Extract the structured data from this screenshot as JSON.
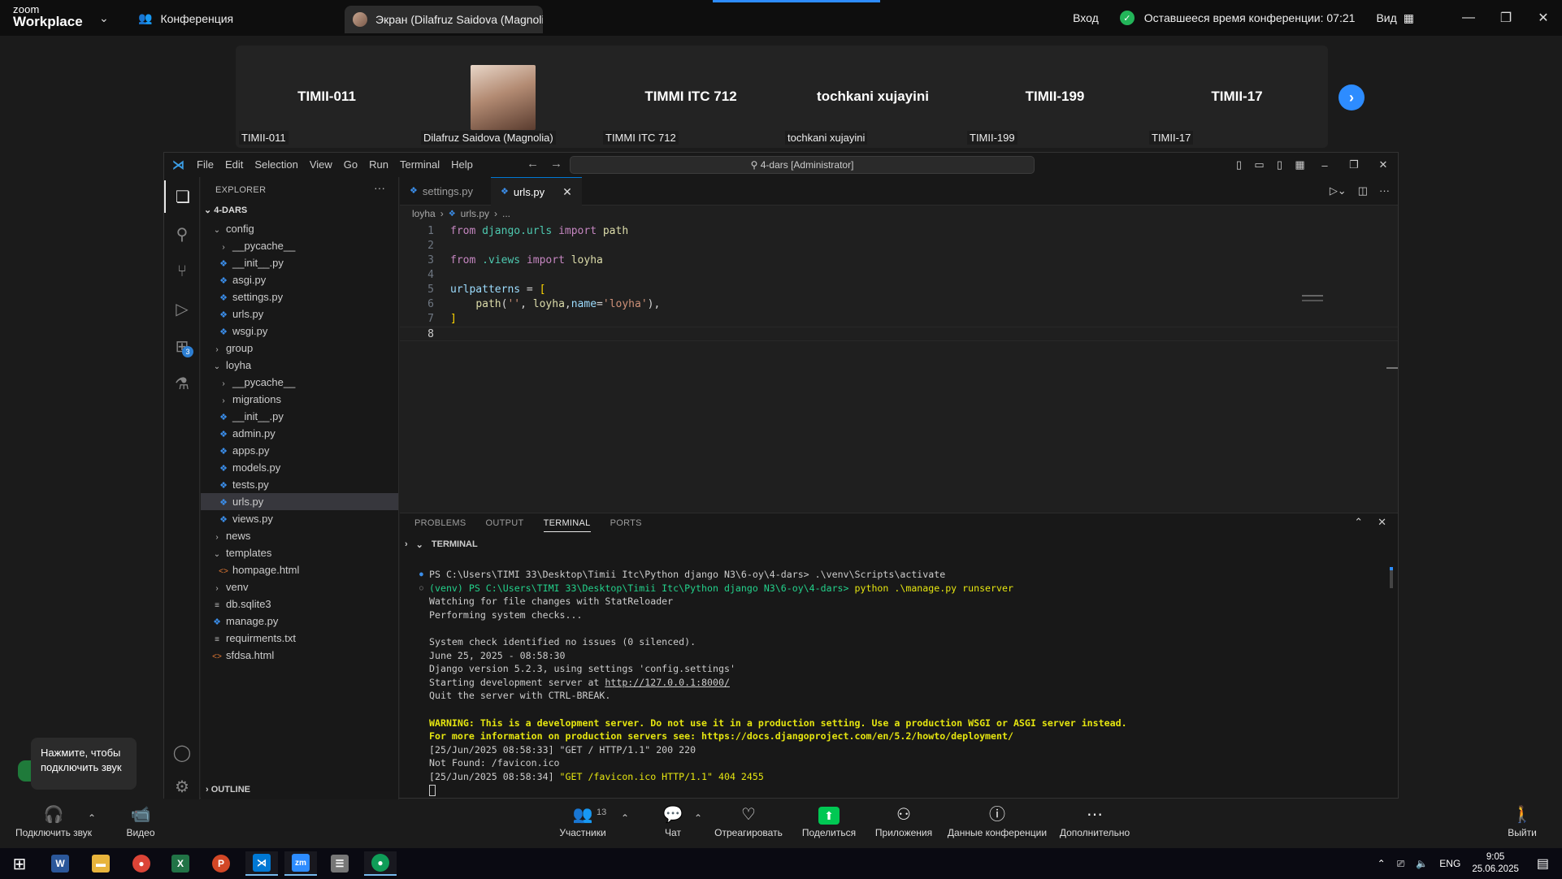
{
  "zoom": {
    "logo_line1": "zoom",
    "logo_line2": "Workplace",
    "conference_label": "Конференция",
    "screen_tab_label": "Экран (Dilafruz Saidova (Magnoli",
    "login_label": "Вход",
    "time_left": "Оставшееся время конференции: 07:21",
    "view_label": "Вид",
    "participants": [
      {
        "big": "TIMII-011",
        "small": "TIMII-011"
      },
      {
        "big": "",
        "small": "Dilafruz Saidova (Magnolia)"
      },
      {
        "big": "TIMMI ITC 712",
        "small": "TIMMI ITC 712"
      },
      {
        "big": "tochkani xujayini",
        "small": "tochkani xujayini"
      },
      {
        "big": "TIMII-199",
        "small": "TIMII-199"
      },
      {
        "big": "TIMII-17",
        "small": "TIMII-17"
      }
    ],
    "tooltip": "Нажмите, чтобы подключить звук",
    "toolbar": {
      "audio": "Подключить звук",
      "video": "Видео",
      "participants": "Участники",
      "participants_count": "13",
      "chat": "Чат",
      "react": "Отреагировать",
      "share": "Поделиться",
      "apps": "Приложения",
      "info": "Данные конференции",
      "more": "Дополнительно",
      "leave": "Выйти"
    }
  },
  "vscode": {
    "menu": [
      "File",
      "Edit",
      "Selection",
      "View",
      "Go",
      "Run",
      "Terminal",
      "Help"
    ],
    "search": "4-dars [Administrator]",
    "explorer_title": "EXPLORER",
    "root_folder": "4-DARS",
    "tree": [
      {
        "label": "config",
        "kind": "folder-open",
        "indent": 1
      },
      {
        "label": "__pycache__",
        "kind": "folder",
        "indent": 2
      },
      {
        "label": "__init__.py",
        "kind": "py",
        "indent": 2
      },
      {
        "label": "asgi.py",
        "kind": "py",
        "indent": 2
      },
      {
        "label": "settings.py",
        "kind": "py",
        "indent": 2
      },
      {
        "label": "urls.py",
        "kind": "py",
        "indent": 2
      },
      {
        "label": "wsgi.py",
        "kind": "py",
        "indent": 2
      },
      {
        "label": "group",
        "kind": "folder",
        "indent": 1
      },
      {
        "label": "loyha",
        "kind": "folder-open",
        "indent": 1
      },
      {
        "label": "__pycache__",
        "kind": "folder",
        "indent": 2
      },
      {
        "label": "migrations",
        "kind": "folder",
        "indent": 2
      },
      {
        "label": "__init__.py",
        "kind": "py",
        "indent": 2
      },
      {
        "label": "admin.py",
        "kind": "py",
        "indent": 2
      },
      {
        "label": "apps.py",
        "kind": "py",
        "indent": 2
      },
      {
        "label": "models.py",
        "kind": "py",
        "indent": 2
      },
      {
        "label": "tests.py",
        "kind": "py",
        "indent": 2
      },
      {
        "label": "urls.py",
        "kind": "py",
        "indent": 2,
        "selected": true
      },
      {
        "label": "views.py",
        "kind": "py",
        "indent": 2
      },
      {
        "label": "news",
        "kind": "folder",
        "indent": 1
      },
      {
        "label": "templates",
        "kind": "folder-open",
        "indent": 1
      },
      {
        "label": "hompage.html",
        "kind": "html",
        "indent": 2
      },
      {
        "label": "venv",
        "kind": "folder",
        "indent": 1
      },
      {
        "label": "db.sqlite3",
        "kind": "txt",
        "indent": 1
      },
      {
        "label": "manage.py",
        "kind": "py",
        "indent": 1
      },
      {
        "label": "requirments.txt",
        "kind": "txt",
        "indent": 1
      },
      {
        "label": "sfdsa.html",
        "kind": "html",
        "indent": 1
      }
    ],
    "outline_label": "OUTLINE",
    "tabs": [
      {
        "label": "settings.py",
        "active": false
      },
      {
        "label": "urls.py",
        "active": true
      }
    ],
    "breadcrumb": [
      "loyha",
      "urls.py",
      "..."
    ],
    "code_lines": [
      "1",
      "2",
      "3",
      "4",
      "5",
      "6",
      "7",
      "8"
    ],
    "panel_tabs": [
      "PROBLEMS",
      "OUTPUT",
      "TERMINAL",
      "PORTS"
    ],
    "terminal_title": "TERMINAL",
    "terminal": [
      "PS C:\\Users\\TIMI 33\\Desktop\\Timii Itc\\Python django N3\\6-oy\\4-dars> ",
      ".\\venv\\Scripts\\activate",
      "(venv) PS C:\\Users\\TIMI 33\\Desktop\\Timii Itc\\Python django N3\\6-oy\\4-dars> ",
      "python .\\manage.py runserver",
      "Watching for file changes with StatReloader",
      "Performing system checks...",
      "System check identified no issues (0 silenced).",
      "June 25, 2025 - 08:58:30",
      "Django version 5.2.3, using settings 'config.settings'",
      "Starting development server at ",
      "http://127.0.0.1:8000/",
      "Quit the server with CTRL-BREAK.",
      "WARNING: This is a development server. Do not use it in a production setting. Use a production WSGI or ASGI server instead.",
      "For more information on production servers see: https://docs.djangoproject.com/en/5.2/howto/deployment/",
      "[25/Jun/2025 08:58:33] \"GET / HTTP/1.1\" 200 220",
      "Not Found: /favicon.ico",
      "[25/Jun/2025 08:58:34] ",
      "\"GET /favicon.ico HTTP/1.1\" 404 2455"
    ]
  },
  "taskbar": {
    "lang": "ENG",
    "time": "9:05",
    "date": "25.06.2025"
  }
}
